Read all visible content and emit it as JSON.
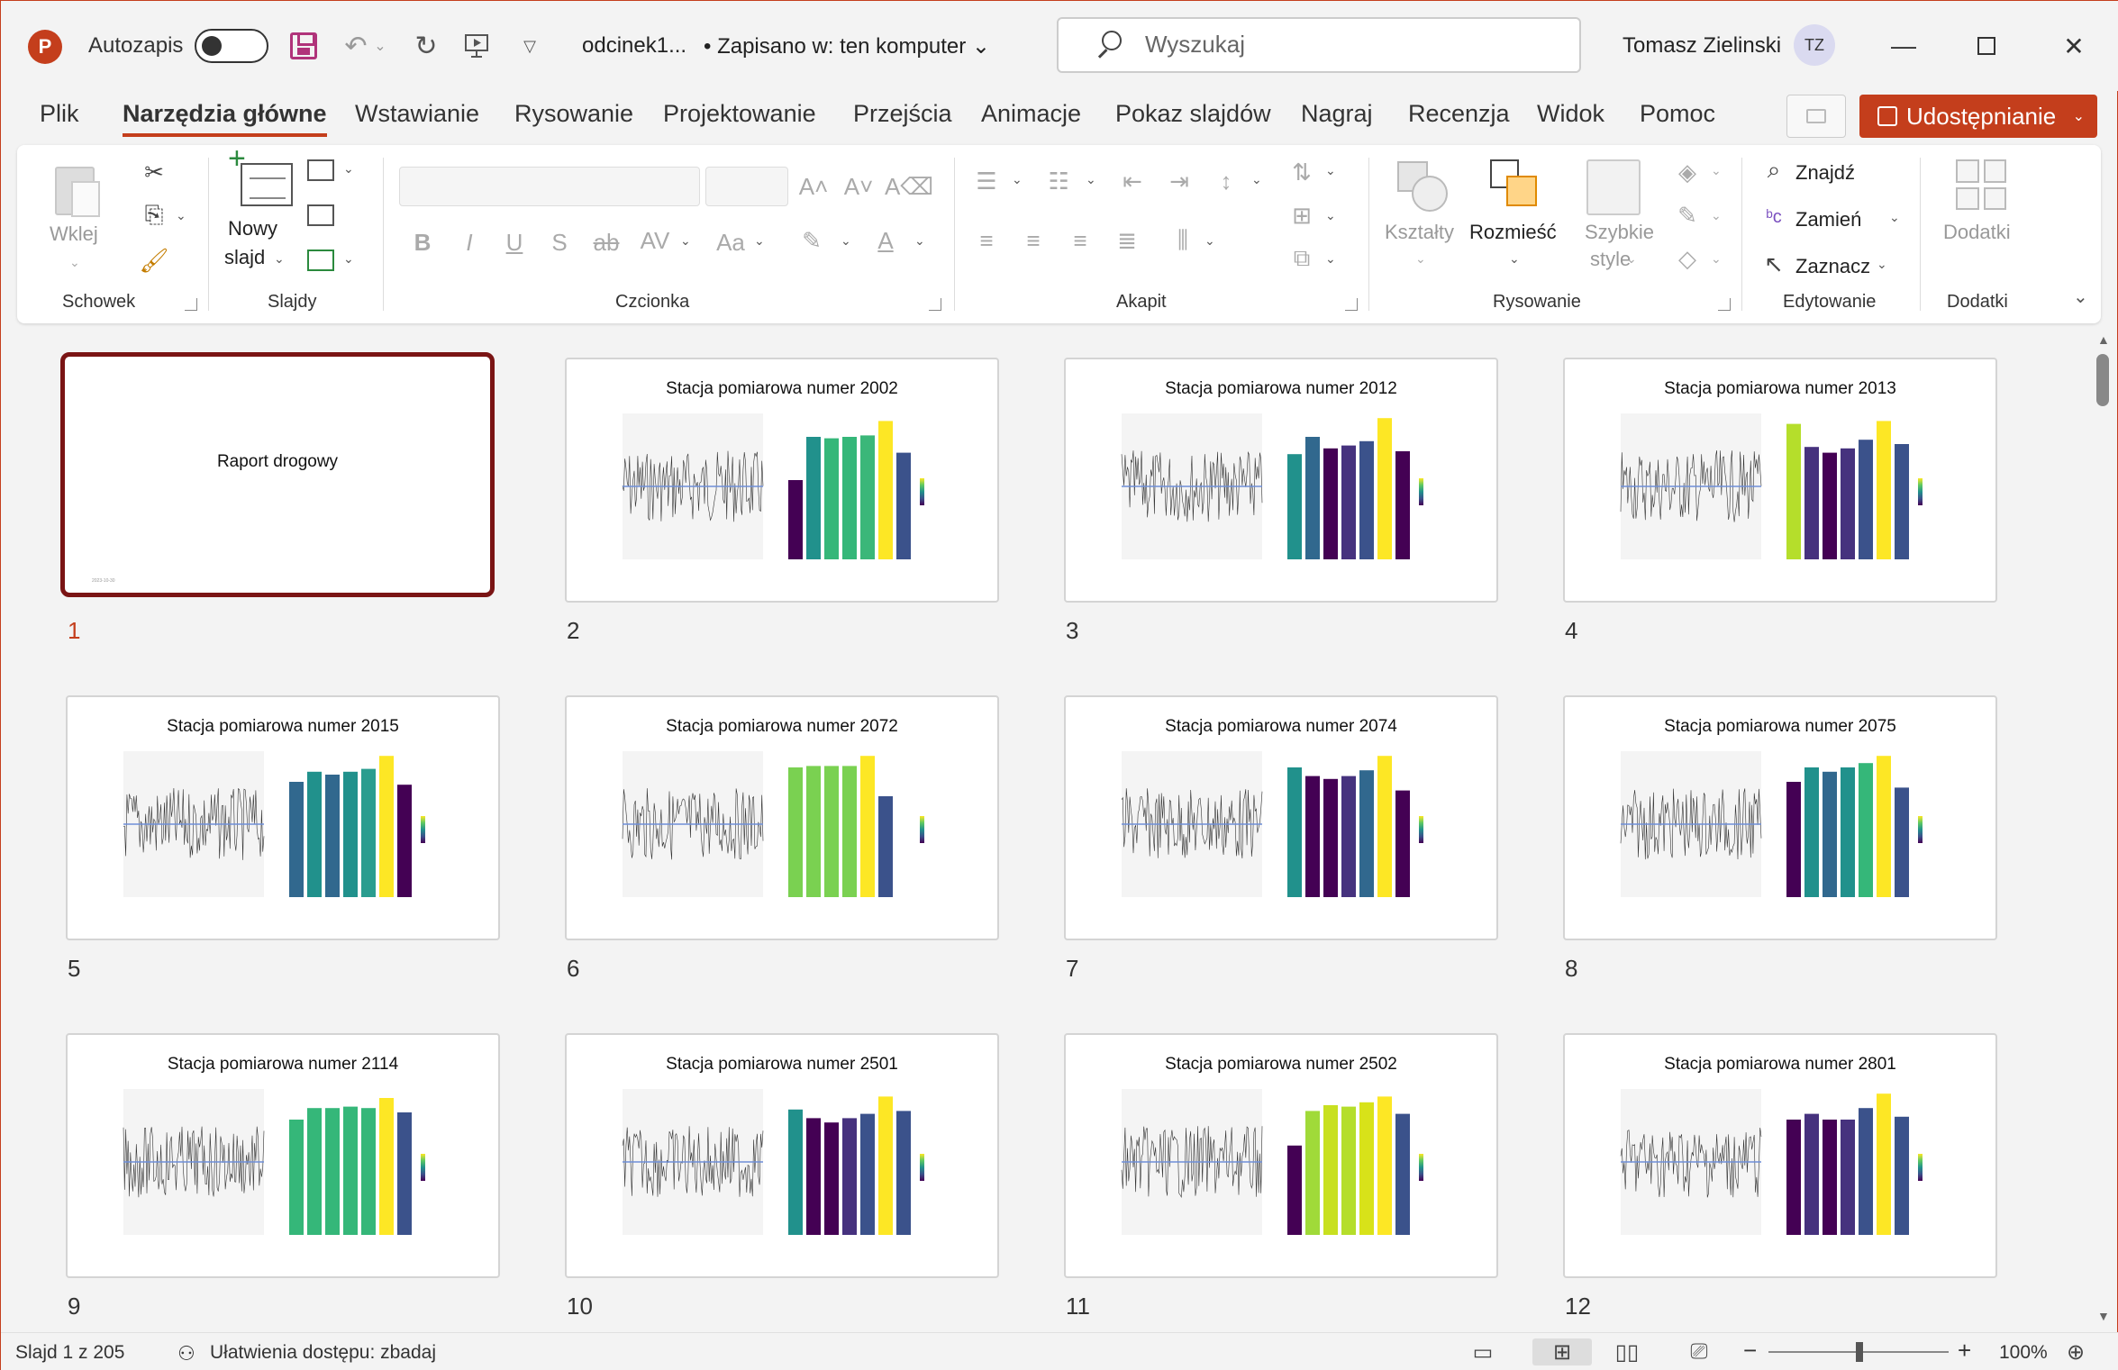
{
  "app": {
    "logo_letter": "P"
  },
  "quick_access": {
    "autosave_label": "Autozapis",
    "autosave_on": false,
    "undo_icon": "undo-icon",
    "redo_icon": "redo-icon",
    "save_icon": "save-icon",
    "present_icon": "present-from-start-icon"
  },
  "document": {
    "title": "odcinek1...",
    "status": "• Zapisano w: ten komputer"
  },
  "search": {
    "placeholder": "Wyszukaj"
  },
  "user": {
    "name": "Tomasz Zielinski",
    "initials": "TZ"
  },
  "tabs": [
    {
      "label": "Plik",
      "active": false
    },
    {
      "label": "Narzędzia główne",
      "active": true
    },
    {
      "label": "Wstawianie",
      "active": false
    },
    {
      "label": "Rysowanie",
      "active": false
    },
    {
      "label": "Projektowanie",
      "active": false
    },
    {
      "label": "Przejścia",
      "active": false
    },
    {
      "label": "Animacje",
      "active": false
    },
    {
      "label": "Pokaz slajdów",
      "active": false
    },
    {
      "label": "Nagraj",
      "active": false
    },
    {
      "label": "Recenzja",
      "active": false
    },
    {
      "label": "Widok",
      "active": false
    },
    {
      "label": "Pomoc",
      "active": false
    }
  ],
  "share_label": "Udostępnianie",
  "ribbon": {
    "groups": {
      "clipboard": "Schowek",
      "slides": "Slajdy",
      "font": "Czcionka",
      "paragraph": "Akapit",
      "drawing": "Rysowanie",
      "editing": "Edytowanie",
      "addins": "Dodatki"
    },
    "paste_label": "Wklej",
    "new_slide_label_1": "Nowy",
    "new_slide_label_2": "slajd",
    "shapes_label": "Kształty",
    "arrange_label": "Rozmieść",
    "quick_styles_label_1": "Szybkie",
    "quick_styles_label_2": "style",
    "find_label": "Znajdź",
    "replace_label": "Zamień",
    "select_label": "Zaznacz",
    "addins_label": "Dodatki",
    "font_buttons": [
      "B",
      "I",
      "U",
      "S",
      "ab",
      "AV",
      "Aa"
    ]
  },
  "slides": [
    {
      "number": "1",
      "title": "Raport drogowy",
      "date": "2023-10-30",
      "type": "title",
      "selected": true
    },
    {
      "number": "2",
      "title": "Stacja pomiarowa numer 2002",
      "type": "chart",
      "bars": [
        0.55,
        0.85,
        0.84,
        0.85,
        0.86,
        0.96,
        0.74
      ],
      "colors": [
        "#440154",
        "#21918c",
        "#35b779",
        "#35b779",
        "#3bb779",
        "#fde725",
        "#3b528b"
      ]
    },
    {
      "number": "3",
      "title": "Stacja pomiarowa numer 2012",
      "type": "chart",
      "bars": [
        0.73,
        0.85,
        0.77,
        0.79,
        0.82,
        0.98,
        0.75
      ],
      "colors": [
        "#21918c",
        "#31688e",
        "#440154",
        "#46327e",
        "#3b528b",
        "#fde725",
        "#440154"
      ]
    },
    {
      "number": "4",
      "title": "Stacja pomiarowa numer 2013",
      "type": "chart",
      "bars": [
        0.94,
        0.78,
        0.74,
        0.77,
        0.83,
        0.96,
        0.8
      ],
      "colors": [
        "#b5de2b",
        "#46327e",
        "#440154",
        "#46327e",
        "#3b528b",
        "#fde725",
        "#3b528b"
      ]
    },
    {
      "number": "5",
      "title": "Stacja pomiarowa numer 2015",
      "type": "chart",
      "bars": [
        0.8,
        0.87,
        0.85,
        0.87,
        0.89,
        0.98,
        0.78
      ],
      "colors": [
        "#31688e",
        "#21918c",
        "#31688e",
        "#21918c",
        "#2a9d8f",
        "#fde725",
        "#440154"
      ]
    },
    {
      "number": "6",
      "title": "Stacja pomiarowa numer 2072",
      "type": "chart",
      "bars": [
        0.9,
        0.91,
        0.91,
        0.91,
        0.98,
        0.7
      ],
      "colors": [
        "#7ad151",
        "#7ad151",
        "#7ad151",
        "#7ad151",
        "#fde725",
        "#3b528b"
      ]
    },
    {
      "number": "7",
      "title": "Stacja pomiarowa numer 2074",
      "type": "chart",
      "bars": [
        0.9,
        0.84,
        0.82,
        0.84,
        0.88,
        0.98,
        0.74
      ],
      "colors": [
        "#21918c",
        "#440154",
        "#440154",
        "#46327e",
        "#31688e",
        "#fde725",
        "#440154"
      ]
    },
    {
      "number": "8",
      "title": "Stacja pomiarowa numer 2075",
      "type": "chart",
      "bars": [
        0.8,
        0.9,
        0.87,
        0.9,
        0.93,
        0.98,
        0.76
      ],
      "colors": [
        "#440154",
        "#21918c",
        "#31688e",
        "#21918c",
        "#35b779",
        "#fde725",
        "#3b528b"
      ]
    },
    {
      "number": "9",
      "title": "Stacja pomiarowa numer 2114",
      "type": "chart",
      "bars": [
        0.8,
        0.88,
        0.88,
        0.89,
        0.88,
        0.95,
        0.85
      ],
      "colors": [
        "#35b779",
        "#35b779",
        "#35b779",
        "#35b779",
        "#35b779",
        "#fde725",
        "#3b528b"
      ]
    },
    {
      "number": "10",
      "title": "Stacja pomiarowa numer 2501",
      "type": "chart",
      "bars": [
        0.87,
        0.81,
        0.78,
        0.81,
        0.84,
        0.96,
        0.86
      ],
      "colors": [
        "#21918c",
        "#440154",
        "#440154",
        "#46327e",
        "#3b528b",
        "#fde725",
        "#3b528b"
      ]
    },
    {
      "number": "11",
      "title": "Stacja pomiarowa numer 2502",
      "type": "chart",
      "bars": [
        0.62,
        0.86,
        0.9,
        0.89,
        0.92,
        0.96,
        0.84
      ],
      "colors": [
        "#440154",
        "#a0da39",
        "#c8e020",
        "#b5de2b",
        "#d8e219",
        "#fde725",
        "#3b528b"
      ]
    },
    {
      "number": "12",
      "title": "Stacja pomiarowa numer 2801",
      "type": "chart",
      "bars": [
        0.8,
        0.84,
        0.8,
        0.8,
        0.88,
        0.98,
        0.82
      ],
      "colors": [
        "#440154",
        "#46327e",
        "#440154",
        "#46327e",
        "#3b528b",
        "#fde725",
        "#3b528b"
      ]
    }
  ],
  "status": {
    "slide_counter": "Slajd 1 z 205",
    "accessibility": "Ułatwienia dostępu: zbadaj",
    "zoom": "100%"
  }
}
